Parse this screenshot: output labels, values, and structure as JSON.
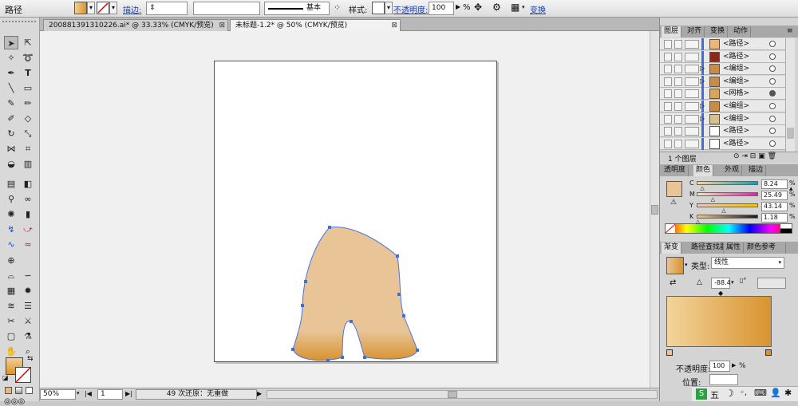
{
  "control_bar": {
    "object_type": "路径",
    "stroke_label": "描边:",
    "stroke_profile": "基本",
    "style_label": "样式:",
    "opacity_label": "不透明度:",
    "opacity_value": "100",
    "opacity_unit": "%",
    "transform_label": "变换"
  },
  "doc_tabs": [
    {
      "label": "200881391310226.ai* @ 33.33% (CMYK/预览)"
    },
    {
      "label": "未标题-1.2* @ 50% (CMYK/预览)"
    }
  ],
  "status_bar": {
    "zoom": "50%",
    "page": "1",
    "message": "49 次还原：无重做"
  },
  "layers_panel": {
    "tabs": [
      "图层",
      "对齐",
      "变换",
      "动作"
    ],
    "rows": [
      {
        "name": "<路径>",
        "thumb": "#e8b87a"
      },
      {
        "name": "<路径>",
        "thumb": "#8a2a1a"
      },
      {
        "name": "<编组>",
        "thumb": "#c98c46",
        "expand": "▷"
      },
      {
        "name": "<编组>",
        "thumb": "#c98c46",
        "expand": "▷"
      },
      {
        "name": "<网格>",
        "thumb": "#d9a45c",
        "filled": true
      },
      {
        "name": "<编组>",
        "thumb": "#c98c46",
        "expand": "▷"
      },
      {
        "name": "<编组>",
        "thumb": "#d9c090",
        "expand": "▷"
      },
      {
        "name": "<路径>",
        "thumb": "#ffffff"
      },
      {
        "name": "<路径>",
        "thumb": "#ffffff"
      }
    ],
    "footer": "1 个图层"
  },
  "color_panel": {
    "tabs": [
      "透明度",
      "颜色",
      "外观",
      "描边"
    ],
    "swatch": "#e8c496",
    "channels": [
      {
        "label": "C",
        "value": "8.24"
      },
      {
        "label": "M",
        "value": "25.49"
      },
      {
        "label": "Y",
        "value": "43.14"
      },
      {
        "label": "K",
        "value": "1.18"
      }
    ]
  },
  "gradient_panel": {
    "tabs": [
      "渐变",
      "路径查找器",
      "属性",
      "颜色参考"
    ],
    "type_label": "类型:",
    "type_value": "线性",
    "angle_value": "-88.4",
    "opacity_label": "不透明度:",
    "opacity_value": "100",
    "location_label": "位置:",
    "percent": "%",
    "stops": [
      "#e8c496",
      "#d9932e"
    ]
  },
  "taskbar": {
    "ime_label": "五"
  },
  "colors": {
    "fill_primary": "#e8c496",
    "fill_gradient_bottom": "#d9932e",
    "selection_blue": "#3f6fd6"
  }
}
